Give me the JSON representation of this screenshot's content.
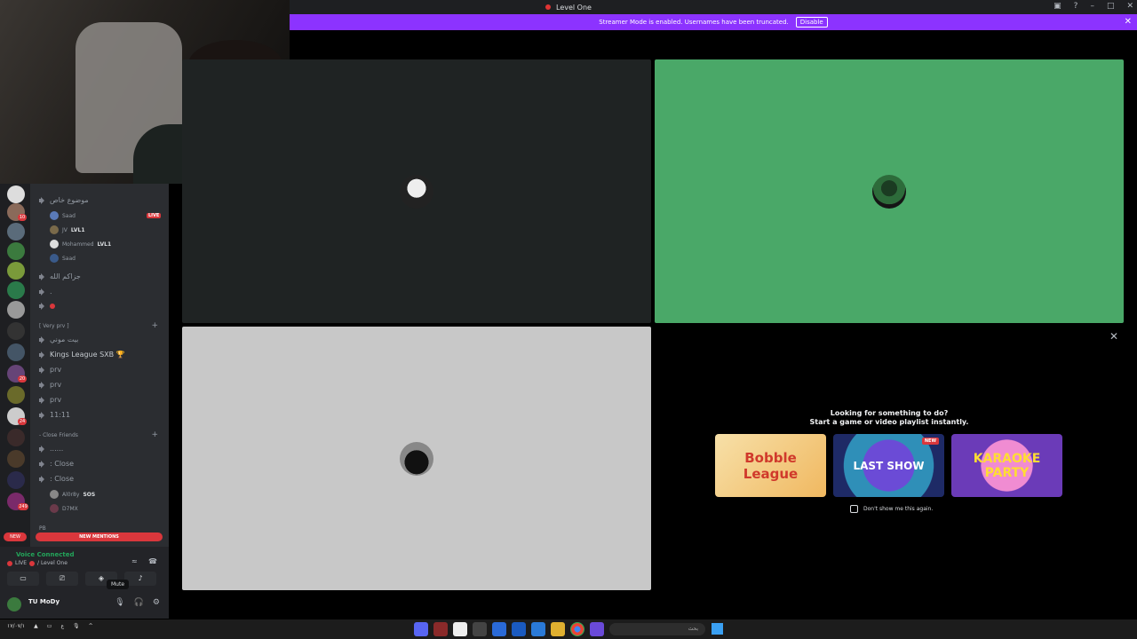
{
  "window": {
    "title": "Level One"
  },
  "banner": {
    "text": "Streamer Mode is enabled. Usernames have been truncated.",
    "button": "Disable"
  },
  "channels": {
    "channel_1": "موضوع خاص",
    "users_1": [
      {
        "name": "Saad",
        "badge": "LIVE"
      },
      {
        "name": "JV",
        "badge": "LVL1"
      },
      {
        "name": "Mohammed",
        "badge": "LVL1"
      },
      {
        "name": "Saad",
        "badge": ""
      }
    ],
    "channel_2": "جزاكم الله",
    "channel_3": ".",
    "category_1": "[ Very prv ]",
    "channel_list_1": [
      "بيت موني",
      "Kings League SXB 🏆",
      "prv",
      "prv",
      "prv",
      "11:11"
    ],
    "category_2": "- Close Friends",
    "channel_list_2": [
      "......",
      ": Close",
      ": Close"
    ],
    "users_2": [
      {
        "name": "Al0r8y",
        "badge": "SOS"
      },
      {
        "name": "D7MX",
        "badge": ""
      }
    ],
    "category_3": "PB",
    "chat_label": "| CHAT",
    "new_pill": "NEW",
    "new_mentions": "NEW MENTIONS"
  },
  "voice": {
    "status": "Voice Connected",
    "live_label": "LIVE",
    "channel": "/ Level One"
  },
  "user": {
    "name": "TU MoDy",
    "tooltip": "Mute"
  },
  "activity": {
    "title_line_1": "Looking for something to do?",
    "title_line_2": "Start a game or video playlist instantly.",
    "cards": [
      {
        "label": "Bobble League",
        "tag": ""
      },
      {
        "label": "LAST SHOW",
        "tag": "NEW"
      },
      {
        "label": "KARAOKE PARTY",
        "tag": ""
      }
    ],
    "checkbox_label": "Don't show me this again."
  },
  "taskbar": {
    "clock": "١٧/٠٧/١",
    "lang": "ع",
    "search": "بحث"
  },
  "colors": {
    "accent": "#8c33ff",
    "live_red": "#da373c",
    "voice_green": "#23a55a"
  }
}
